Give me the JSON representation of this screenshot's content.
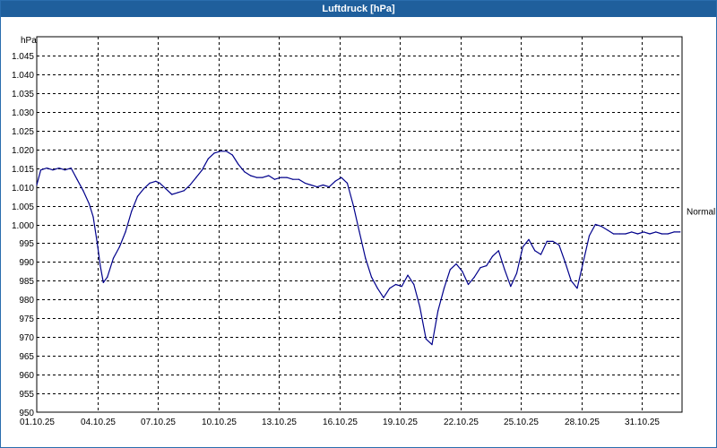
{
  "window": {
    "title": "Luftdruck [hPa]"
  },
  "chart_data": {
    "type": "line",
    "title": "Luftdruck [hPa]",
    "ylabel": "hPa",
    "xlabel": "",
    "ylim": [
      950,
      1050
    ],
    "xlim_days": [
      1,
      33
    ],
    "grid": true,
    "y_ticks": [
      950,
      955,
      960,
      965,
      970,
      975,
      980,
      985,
      990,
      995,
      1000,
      1005,
      1010,
      1015,
      1020,
      1025,
      1030,
      1035,
      1040,
      1045
    ],
    "y_tick_labels": [
      "950",
      "955",
      "960",
      "965",
      "970",
      "975",
      "980",
      "985",
      "990",
      "995",
      "1.000",
      "1.005",
      "1.010",
      "1.015",
      "1.020",
      "1.025",
      "1.030",
      "1.035",
      "1.040",
      "1.045"
    ],
    "x_ticks": [
      "01.10.25",
      "04.10.25",
      "07.10.25",
      "10.10.25",
      "13.10.25",
      "16.10.25",
      "19.10.25",
      "22.10.25",
      "25.10.25",
      "28.10.25",
      "31.10.25"
    ],
    "x_tick_days": [
      1,
      4,
      7,
      10,
      13,
      16,
      19,
      22,
      25,
      28,
      31
    ],
    "reference_line": {
      "label": "Normal",
      "value": 1003.5
    },
    "line_color": "#00008b",
    "series": [
      {
        "x": [
          1.0,
          1.2,
          1.5,
          1.8,
          2.1,
          2.4,
          2.7,
          3.0,
          3.3,
          3.6,
          3.8,
          4.0,
          4.15,
          4.3,
          4.5,
          4.8,
          5.1,
          5.4,
          5.7,
          6.0,
          6.3,
          6.6,
          6.9,
          7.1,
          7.4,
          7.7,
          8.0,
          8.3,
          8.6,
          8.9,
          9.2,
          9.5,
          9.8,
          10.1,
          10.4,
          10.7,
          11.0,
          11.3,
          11.6,
          11.9,
          12.2,
          12.5,
          12.8,
          13.1,
          13.4,
          13.7,
          14.0,
          14.3,
          14.6,
          14.9,
          15.2,
          15.5,
          15.8,
          16.1,
          16.4,
          16.7,
          17.0,
          17.3,
          17.6,
          17.9,
          18.2,
          18.5,
          18.8,
          19.1,
          19.4,
          19.7,
          20.0,
          20.3,
          20.6,
          20.9,
          21.2,
          21.5,
          21.8,
          22.1,
          22.4,
          22.7,
          23.0,
          23.3,
          23.6,
          23.9,
          24.2,
          24.5,
          24.8,
          25.1,
          25.4,
          25.7,
          26.0,
          26.3,
          26.6,
          26.9,
          27.2,
          27.5,
          27.8,
          28.1,
          28.4,
          28.7,
          29.0,
          29.3,
          29.6,
          29.9,
          30.2,
          30.5,
          30.8,
          31.1,
          31.4,
          31.7,
          32.0,
          32.3,
          32.6,
          32.9
        ],
        "values": [
          1010.5,
          1014.5,
          1015.0,
          1014.5,
          1015.0,
          1014.5,
          1015.0,
          1012.0,
          1009.0,
          1005.5,
          1002.0,
          995.0,
          989.0,
          984.5,
          986.0,
          991.0,
          994.0,
          998.0,
          1003.5,
          1007.5,
          1009.5,
          1011.0,
          1011.5,
          1011.0,
          1009.5,
          1008.0,
          1008.5,
          1009.0,
          1010.5,
          1012.5,
          1014.5,
          1017.5,
          1019.0,
          1019.5,
          1019.5,
          1018.5,
          1016.0,
          1014.0,
          1013.0,
          1012.5,
          1012.5,
          1013.0,
          1012.0,
          1012.5,
          1012.5,
          1012.0,
          1012.0,
          1011.0,
          1010.5,
          1010.0,
          1010.5,
          1010.0,
          1011.5,
          1012.5,
          1011.0,
          1005.0,
          998.0,
          991.0,
          986.0,
          983.0,
          980.5,
          983.0,
          984.0,
          983.5,
          986.5,
          984.0,
          978.0,
          969.5,
          968.0,
          977.0,
          983.0,
          988.0,
          989.5,
          987.5,
          984.0,
          986.0,
          988.5,
          989.0,
          991.5,
          993.0,
          988.0,
          983.5,
          987.0,
          994.0,
          996.0,
          993.0,
          992.0,
          995.5,
          995.5,
          994.5,
          990.0,
          985.0,
          983.0,
          990.0,
          997.0,
          1000.0,
          999.5,
          998.5,
          997.5,
          997.5,
          997.5,
          998.0,
          997.5,
          998.0,
          997.5,
          998.0,
          997.5,
          997.5,
          998.0,
          998.0
        ]
      }
    ]
  }
}
